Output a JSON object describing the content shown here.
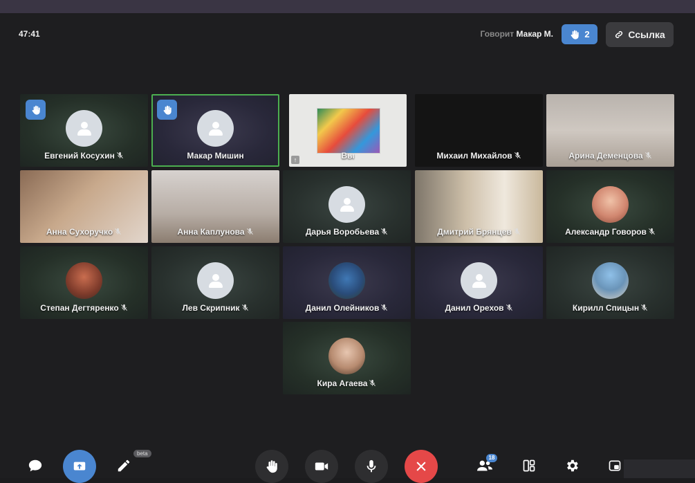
{
  "header": {
    "timer": "47:41",
    "speaking_label": "Говорит",
    "speaking_name": "Макар М.",
    "raised_hands_count": "2",
    "link_label": "Ссылка"
  },
  "participants": [
    {
      "name": "Евгений Косухин",
      "muted": true,
      "hand_raised": true
    },
    {
      "name": "Макар Мишин",
      "muted": false,
      "hand_raised": true,
      "speaking": true
    },
    {
      "name": "Вы",
      "muted": false,
      "screen_sharing": true
    },
    {
      "name": "Михаил Михайлов",
      "muted": true
    },
    {
      "name": "Арина Деменцова",
      "muted": true
    },
    {
      "name": "Анна Сухоручко",
      "muted": true
    },
    {
      "name": "Анна Каплунова",
      "muted": true
    },
    {
      "name": "Дарья Воробьева",
      "muted": true
    },
    {
      "name": "Дмитрий Брянцев",
      "muted": true
    },
    {
      "name": "Александр Говоров",
      "muted": true
    },
    {
      "name": "Степан Дегтяренко",
      "muted": true
    },
    {
      "name": "Лев Скрипник",
      "muted": true
    },
    {
      "name": "Данил Олейников",
      "muted": true
    },
    {
      "name": "Данил Орехов",
      "muted": true
    },
    {
      "name": "Кирилл Спицын",
      "muted": true
    },
    {
      "name": "Кира Агаева",
      "muted": true
    }
  ],
  "toolbar": {
    "chat_icon": "chat-icon",
    "share_screen_icon": "share-screen-icon",
    "whiteboard_icon": "pencil-icon",
    "whiteboard_badge": "beta",
    "raise_hand_icon": "hand-icon",
    "camera_icon": "camera-icon",
    "mic_icon": "microphone-icon",
    "end_call_icon": "close-icon",
    "participants_icon": "people-icon",
    "participants_count": "18",
    "layout_icon": "layout-icon",
    "settings_icon": "gear-icon",
    "pip_icon": "pip-icon"
  },
  "colors": {
    "accent_blue": "#4a86d0",
    "end_call_red": "#e54848",
    "speaking_green": "#4caf50",
    "background": "#1c1c1e"
  }
}
